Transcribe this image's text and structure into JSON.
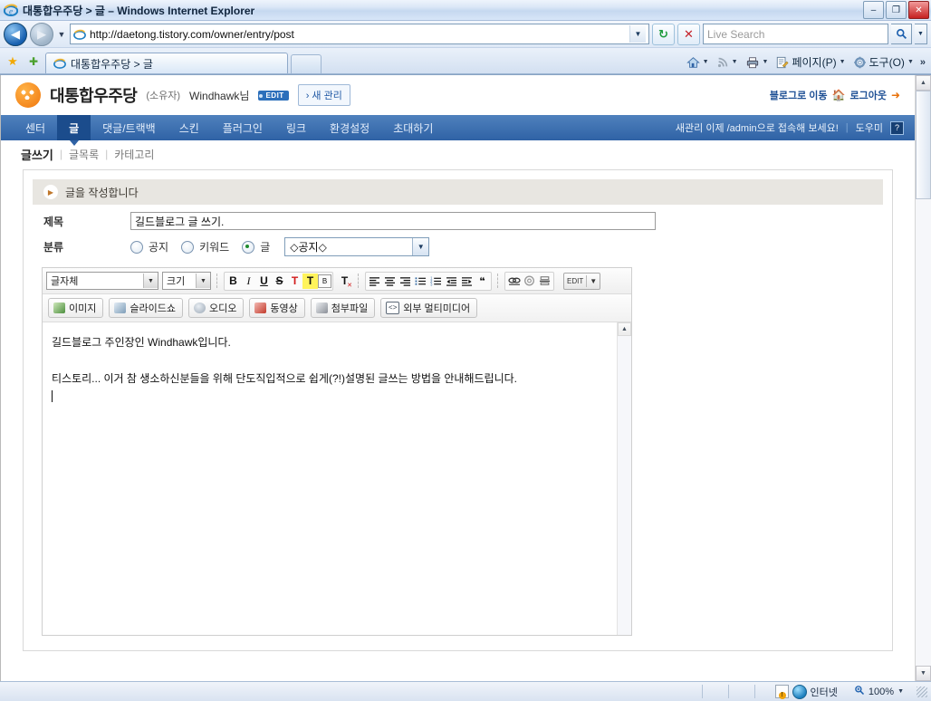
{
  "window": {
    "title": "대통합우주당 > 글 – Windows Internet Explorer",
    "minimize": "–",
    "restore": "❐",
    "close": "✕"
  },
  "address": {
    "back": "◀",
    "forward": "▶",
    "dropdown": "▼",
    "url": "http://daetong.tistory.com/owner/entry/post",
    "url_caret": "▼",
    "refresh": "↻",
    "stop": "✕",
    "search_placeholder": "Live Search",
    "search_value": "",
    "search_go": "🔍",
    "search_dropdown": "▼"
  },
  "tabs": {
    "favorites_star": "★",
    "add_favorite": "✚",
    "items": [
      {
        "label": "대통합우주당 > 글"
      }
    ],
    "new_tab": ""
  },
  "command_bar": {
    "home": "🏠",
    "home_caret": "▼",
    "feeds": "📶",
    "feeds_caret": "▼",
    "print": "🖶",
    "print_caret": "▼",
    "page_label": "페이지(P)",
    "page_caret": "▼",
    "tools_label": "도구(O)",
    "tools_caret": "▼",
    "overflow": "»"
  },
  "site": {
    "blog_name": "대통합우주당",
    "owner_label": "(소유자)",
    "user_name": "Windhawk님",
    "edit_badge": "EDIT",
    "new_admin_button": "› 새 관리",
    "go_blog": "블로그로 이동",
    "go_blog_icon": "🏠",
    "logout": "로그아웃",
    "logout_icon": "➜",
    "nav": [
      {
        "label": "센터",
        "active": false
      },
      {
        "label": "글",
        "active": true
      },
      {
        "label": "댓글/트랙백",
        "active": false
      },
      {
        "label": "스킨",
        "active": false
      },
      {
        "label": "플러그인",
        "active": false
      },
      {
        "label": "링크",
        "active": false
      },
      {
        "label": "환경설정",
        "active": false
      },
      {
        "label": "초대하기",
        "active": false
      }
    ],
    "nav_notice": "새관리 이제 /admin으로 접속해 보세요!",
    "nav_sep": "|",
    "help_label": "도우미",
    "help_icon": "?",
    "subnav": {
      "current": "글쓰기",
      "bar1": "|",
      "item2": "글목록",
      "bar2": "|",
      "item3": "카테고리"
    }
  },
  "panel": {
    "header_title": "글을 작성합니다",
    "header_icon": "▶",
    "title_label": "제목",
    "title_value": "길드블로그 글 쓰기.",
    "category_label": "분류",
    "radios": [
      {
        "label": "공지",
        "selected": false
      },
      {
        "label": "키워드",
        "selected": false
      },
      {
        "label": "글",
        "selected": true
      }
    ],
    "category_select": "◇공지◇",
    "select_arrow": "▼"
  },
  "editor": {
    "font_select": "글자체",
    "size_select": "크기",
    "select_arrow": "▼",
    "format_buttons": [
      {
        "name": "bold",
        "glyph": "B",
        "style": "bold"
      },
      {
        "name": "italic",
        "glyph": "I",
        "style": "italic"
      },
      {
        "name": "underline",
        "glyph": "U",
        "style": "underline"
      },
      {
        "name": "strikethrough",
        "glyph": "S",
        "style": "strike"
      },
      {
        "name": "font-color",
        "glyph": "T",
        "style": "red"
      },
      {
        "name": "highlight-color",
        "glyph": "T",
        "style": "hl"
      },
      {
        "name": "background-color",
        "glyph": "B",
        "style": "boxed"
      }
    ],
    "clear_format": "T",
    "clear_format_x": "✕",
    "align_buttons": [
      {
        "name": "align-left",
        "glyph": "≡"
      },
      {
        "name": "align-center",
        "glyph": "≡"
      },
      {
        "name": "align-right",
        "glyph": "≡"
      },
      {
        "name": "bullet-list",
        "glyph": "⁞≡"
      },
      {
        "name": "number-list",
        "glyph": "⁞≡"
      },
      {
        "name": "outdent",
        "glyph": "◀≡"
      },
      {
        "name": "indent",
        "glyph": "≡▶"
      },
      {
        "name": "blockquote",
        "glyph": "❝"
      }
    ],
    "insert_buttons": [
      {
        "name": "link",
        "glyph": "⚭"
      },
      {
        "name": "emoticon",
        "glyph": "◎"
      },
      {
        "name": "horizontal-rule",
        "glyph": "⊟"
      }
    ],
    "edit_mode_button": "EDIT",
    "edit_mode_caret": "▼",
    "media_buttons": [
      {
        "label": "이미지",
        "color": "#4c8f3e"
      },
      {
        "label": "슬라이드쇼",
        "color": "#7e9db8"
      },
      {
        "label": "오디오",
        "color": "#9aa7b5"
      },
      {
        "label": "동영상",
        "color": "#c23a2b"
      },
      {
        "label": "첨부파일",
        "color": "#8a8f97"
      },
      {
        "label": "외부 멀티미디어",
        "color": "#5d6a78"
      }
    ],
    "content_lines": [
      "길드블로그 주인장인 Windhawk입니다.",
      "",
      "티스토리... 이거 참 생소하신분들을 위해 단도직입적으로 쉽게(?!)설명된 글쓰는 방법을 안내해드립니다."
    ],
    "scroll_up": "▲"
  },
  "status": {
    "zone": "인터넷",
    "zoom": "100%",
    "zoom_caret": "▼",
    "zoom_icon": "🔍"
  },
  "scroll": {
    "up": "▲",
    "down": "▼"
  },
  "colors": {
    "nav_blue": "#2f62a5",
    "nav_active": "#1b4c8c",
    "logo_orange": "#f0760d",
    "link_blue": "#1d4f94",
    "panel_header": "#e8e6e1"
  }
}
